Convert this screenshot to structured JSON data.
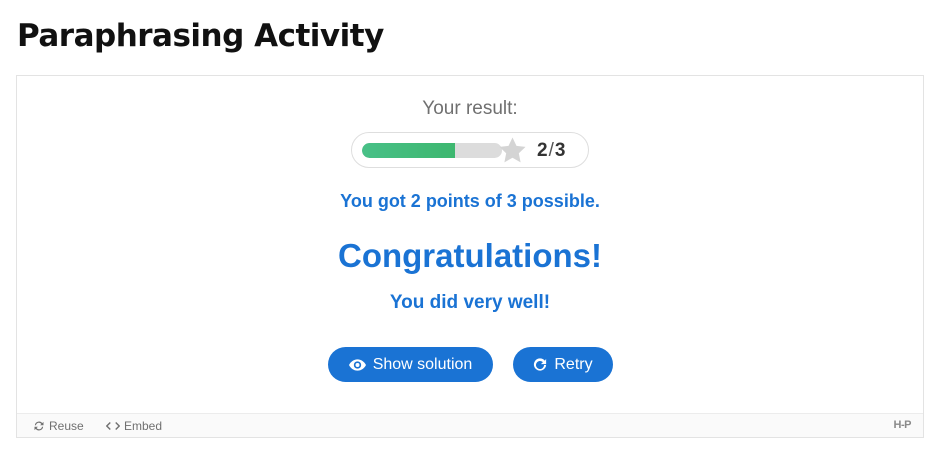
{
  "page": {
    "title": "Paraphrasing Activity"
  },
  "result": {
    "label": "Your result:",
    "score": "2",
    "separator": "/",
    "max": "3",
    "progress_fraction": 0.667,
    "points_message": "You got 2 points of 3 possible.",
    "heading": "Congratulations!",
    "feedback": "You did very well!"
  },
  "buttons": {
    "show_solution_label": "Show solution",
    "retry_label": "Retry"
  },
  "footer": {
    "reuse_label": "Reuse",
    "embed_label": "Embed",
    "logo_text": "H-P"
  },
  "icons": {
    "star": "star-icon",
    "show_solution": "eye-icon",
    "retry": "retry-icon",
    "reuse": "reuse-icon",
    "embed": "code-icon"
  },
  "colors": {
    "accent": "#1a73d4",
    "progress": "#44bd7c",
    "track": "#dcdcdc",
    "star": "#d4d4d4"
  }
}
